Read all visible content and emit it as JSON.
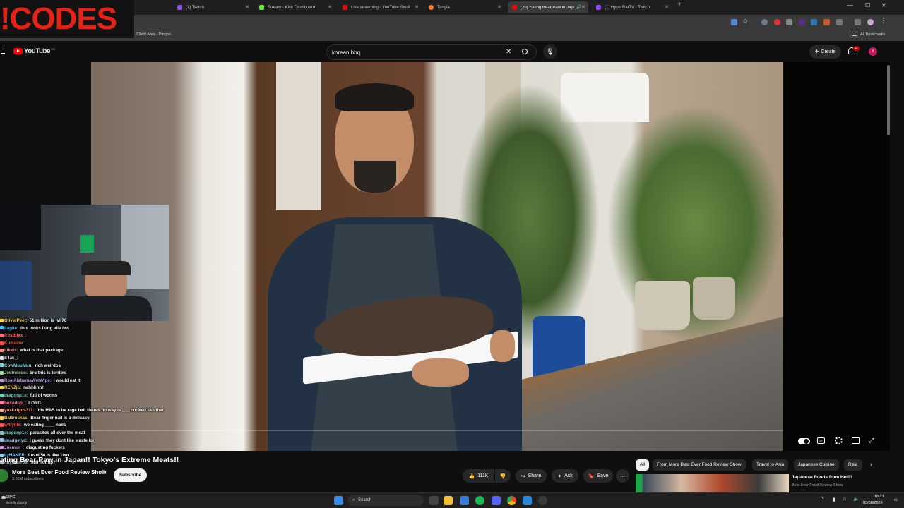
{
  "browser": {
    "tabs": [
      {
        "label": "(1) Twitch",
        "color": "#9146ff"
      },
      {
        "label": "Stream - Kick Dashboard",
        "color": "#53fc18"
      },
      {
        "label": "Live streaming - YouTube Studi",
        "color": "#ff0000"
      },
      {
        "label": "Tangia",
        "color": "#ff7a2d"
      },
      {
        "label": "(20) Eating Bear Paw in Japa",
        "color": "#ff0000",
        "active": true
      },
      {
        "label": "(1) HyperRatTV - Twitch",
        "color": "#9146ff"
      }
    ],
    "bookmark_left": "Client Area - Pingpe...",
    "bookmark_right": "All Bookmarks"
  },
  "overlay": {
    "codes_text": "!CODES"
  },
  "youtube": {
    "logo_text": "YouTube",
    "logo_region": "GB",
    "search_value": "korean bbq",
    "create_label": "Create",
    "notification_count": "9+",
    "avatar_letter": "T"
  },
  "video": {
    "title": "ating Bear Paw in Japan!! Tokyo's Extreme Meats!!",
    "channel": "More Best Ever Food Review Show",
    "subscribers": "3.86M subscribers",
    "subscribe_label": "Subscribe",
    "likes": "111K",
    "share_label": "Share",
    "ask_label": "Ask",
    "save_label": "Save",
    "more_label": "..."
  },
  "chips": [
    "All",
    "From More Best Ever Food Review Show",
    "Travel to Asia",
    "Japanese Cuisine",
    "Rela"
  ],
  "recommended": {
    "title": "Japanese Foods from Hell!!",
    "channel": "Best Ever Food Review Show"
  },
  "chat": [
    {
      "user": "OliverPeet:",
      "msg": "51 million is lvl 70",
      "color": "#ffd54a"
    },
    {
      "user": "Laglie:",
      "msg": "this looks fking vile bro",
      "color": "#4fc3f7"
    },
    {
      "user": "frostbixx_:",
      "msg": "",
      "color": "#ff6f6f"
    },
    {
      "user": "Kumaine:",
      "msg": "",
      "color": "#ff4d4d"
    },
    {
      "user": "Likeis:",
      "msg": "what is that package",
      "color": "#ff8a80"
    },
    {
      "user": "S4ak_:",
      "msg": "",
      "color": "#e0e0e0"
    },
    {
      "user": "CowMuuMuu:",
      "msg": "rich weirdos",
      "color": "#80deea"
    },
    {
      "user": "Jestreloco:",
      "msg": "bro this is terrible",
      "color": "#a5d6a7"
    },
    {
      "user": "RealAlabamaWetWipe:",
      "msg": "i would eat it",
      "color": "#b39ddb"
    },
    {
      "user": "RENZjc:",
      "msg": "nahhhhhh",
      "color": "#ffd54a"
    },
    {
      "user": "dragonp1e:",
      "msg": "full of worms",
      "color": "#80cbc4"
    },
    {
      "user": "boxedup_:",
      "msg": "LORD",
      "color": "#ff80ab"
    },
    {
      "user": "yoskxfgos311:",
      "msg": "this HAS to be rage bait theres no way is ___ cooked like that",
      "color": "#ffab91"
    },
    {
      "user": "BaBrockas:",
      "msg": "Bear finger nail is a delicacy",
      "color": "#ffd54a"
    },
    {
      "user": "w4fynlx:",
      "msg": "we eating ____ nails",
      "color": "#ff5252"
    },
    {
      "user": "dragonp1e:",
      "msg": "parasites all over the meat",
      "color": "#80cbc4"
    },
    {
      "user": "deadgetyd:",
      "msg": "i guess they dont like waste lol",
      "color": "#90caf9"
    },
    {
      "user": "Joemor_:",
      "msg": "disgusting fuckers",
      "color": "#ce93d8"
    },
    {
      "user": "ItzHAKER:",
      "msg": "Level 50 is like 10m",
      "color": "#81d4fa"
    },
    {
      "user": "hayaastros:",
      "msg": "still not up?",
      "color": "#b0bec5"
    }
  ],
  "taskbar": {
    "weather_temp": "29°C",
    "weather_desc": "Mostly cloudy",
    "search_label": "Search",
    "time": "16:21",
    "date": "03/08/2026"
  }
}
